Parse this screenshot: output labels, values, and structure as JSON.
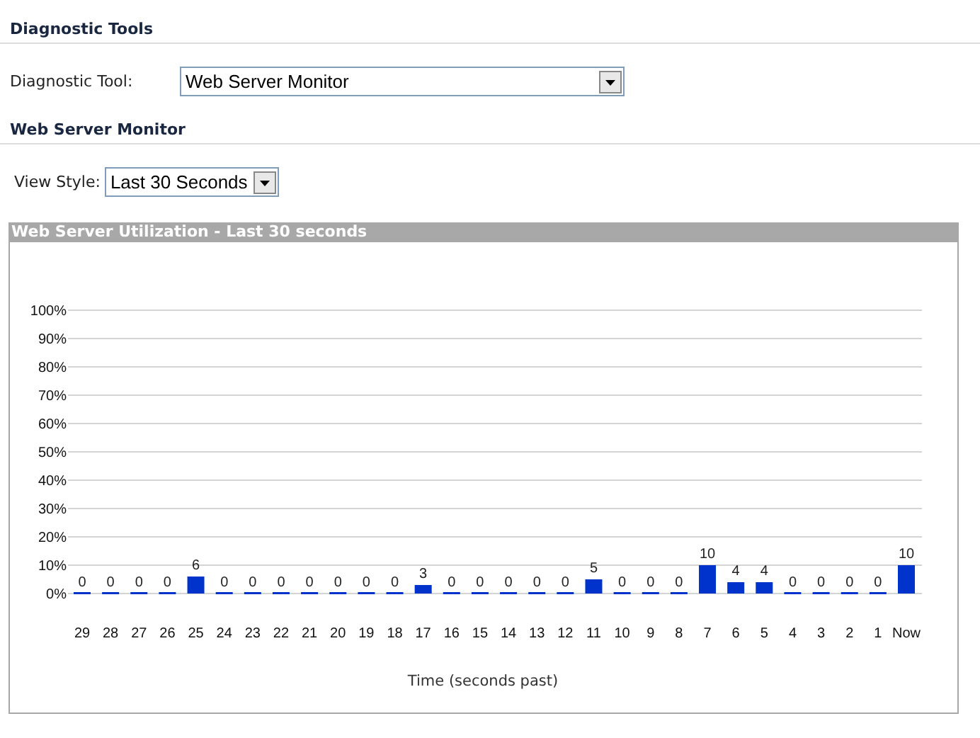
{
  "sections": [
    {
      "title": "Diagnostic Tools",
      "field": {
        "label": "Diagnostic Tool:",
        "value": "Web Server Monitor",
        "kind": "wide"
      }
    },
    {
      "title": "Web Server Monitor",
      "field": {
        "label": "View Style:",
        "value": "Last 30 Seconds",
        "kind": "narrow"
      }
    }
  ],
  "panel": {
    "title": "Web Server Utilization - Last 30 seconds",
    "chart_data": {
      "type": "bar",
      "xlabel": "Time (seconds past)",
      "categories": [
        "29",
        "28",
        "27",
        "26",
        "25",
        "24",
        "23",
        "22",
        "21",
        "20",
        "19",
        "18",
        "17",
        "16",
        "15",
        "14",
        "13",
        "12",
        "11",
        "10",
        "9",
        "8",
        "7",
        "6",
        "5",
        "4",
        "3",
        "2",
        "1",
        "Now"
      ],
      "grid": true,
      "series": [
        {
          "color": "#0033cc",
          "values": [
            0,
            0,
            0,
            0,
            6,
            0,
            0,
            0,
            0,
            0,
            0,
            0,
            3,
            0,
            0,
            0,
            0,
            0,
            5,
            0,
            0,
            0,
            10,
            4,
            4,
            0,
            0,
            0,
            0,
            10
          ]
        }
      ],
      "ylim": [
        0,
        100
      ],
      "yticks": [
        {
          "value": 0,
          "label": "0%"
        },
        {
          "value": 10,
          "label": "10%"
        },
        {
          "value": 20,
          "label": "20%"
        },
        {
          "value": 30,
          "label": "30%"
        },
        {
          "value": 40,
          "label": "40%"
        },
        {
          "value": 50,
          "label": "50%"
        },
        {
          "value": 60,
          "label": "60%"
        },
        {
          "value": 70,
          "label": "70%"
        },
        {
          "value": 80,
          "label": "80%"
        },
        {
          "value": 90,
          "label": "90%"
        },
        {
          "value": 100,
          "label": "100%"
        }
      ],
      "data_labels": true
    }
  }
}
